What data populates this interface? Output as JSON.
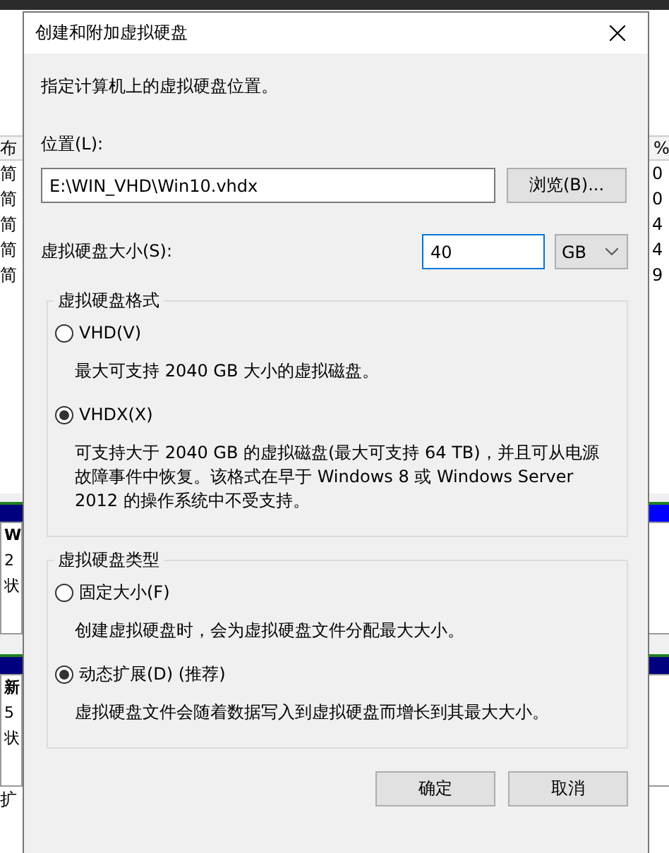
{
  "background": {
    "left": {
      "header": "布",
      "rows": [
        "简",
        "简",
        "简",
        "简",
        "简"
      ],
      "disks": [
        {
          "name": "W",
          "size": "2",
          "status": "状"
        },
        {
          "name": "新",
          "size": "5",
          "status": "状"
        }
      ],
      "legend": "扩"
    },
    "right": {
      "header": "%",
      "rows": [
        "0",
        "0",
        "4",
        "4",
        "9"
      ]
    }
  },
  "dialog": {
    "title": "创建和附加虚拟硬盘",
    "description": "指定计算机上的虚拟硬盘位置。",
    "location": {
      "label": "位置(L):",
      "value": "E:\\WIN_VHD\\Win10.vhdx",
      "browse_button": "浏览(B)..."
    },
    "size": {
      "label": "虚拟硬盘大小(S):",
      "value": "40",
      "unit": "GB"
    },
    "groups": [
      {
        "title": "虚拟硬盘格式",
        "options": [
          {
            "label": "VHD(V)",
            "selected": false,
            "description": "最大可支持 2040 GB 大小的虚拟磁盘。"
          },
          {
            "label": "VHDX(X)",
            "selected": true,
            "description": "可支持大于 2040 GB 的虚拟磁盘(最大可支持 64 TB)，并且可从电源故障事件中恢复。该格式在早于 Windows 8 或 Windows Server 2012 的操作系统中不受支持。"
          }
        ]
      },
      {
        "title": "虚拟硬盘类型",
        "options": [
          {
            "label": "固定大小(F)",
            "selected": false,
            "description": "创建虚拟硬盘时，会为虚拟硬盘文件分配最大大小。"
          },
          {
            "label": "动态扩展(D) (推荐)",
            "selected": true,
            "description": "虚拟硬盘文件会随着数据写入到虚拟硬盘而增长到其最大大小。"
          }
        ]
      }
    ],
    "buttons": [
      "确定",
      "取消"
    ]
  }
}
